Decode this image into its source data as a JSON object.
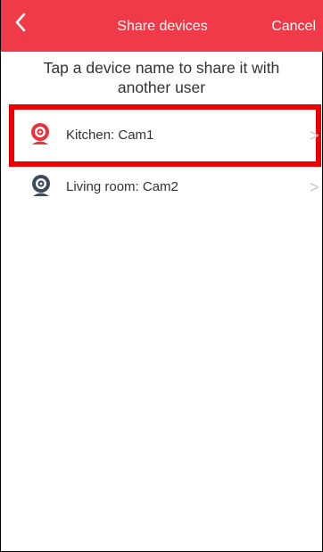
{
  "header": {
    "title": "Share devices",
    "cancel_label": "Cancel",
    "background_color": "#f03a47"
  },
  "instruction": "Tap a device name to share it with another user",
  "devices": [
    {
      "label": "Kitchen: Cam1",
      "icon": "camera-icon",
      "icon_color": "#e8323e",
      "selected": true
    },
    {
      "label": "Living room: Cam2",
      "icon": "camera-icon",
      "icon_color": "#3d4a5c",
      "selected": false
    }
  ],
  "selection_highlight_color": "#ee0000",
  "chevron_glyph": ">"
}
